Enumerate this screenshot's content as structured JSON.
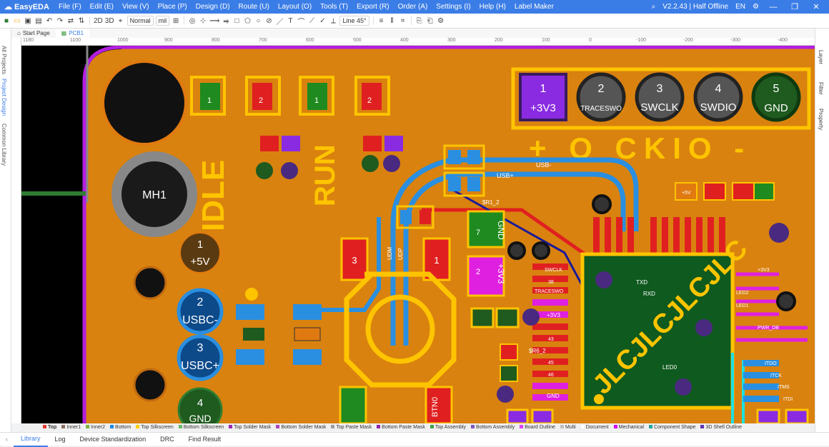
{
  "app": {
    "name": "EasyEDA",
    "version": "V2.2.43 | Half Offline",
    "lang": "EN"
  },
  "menu": [
    "File (F)",
    "Edit (E)",
    "View (V)",
    "Place (P)",
    "Design (D)",
    "Route (U)",
    "Layout (O)",
    "Tools (T)",
    "Export (R)",
    "Order (A)",
    "Settings (I)",
    "Help (H)",
    "Label Maker"
  ],
  "toolbar": {
    "view2d": "2D",
    "view3d": "3D",
    "mode": "Normal",
    "unit": "mil",
    "line_angle": "Line 45°"
  },
  "left_tabs": [
    "All Projects",
    "Project Design",
    "Common Library"
  ],
  "right_tabs": [
    "Layer",
    "Filter",
    "Property"
  ],
  "doc_tabs": [
    "Start Page",
    "PCB1"
  ],
  "ruler": [
    "1180",
    "1100",
    "1000",
    "900",
    "800",
    "700",
    "600",
    "500",
    "400",
    "300",
    "200",
    "100",
    "0",
    "-100",
    "-200",
    "-300",
    "-400"
  ],
  "pcb": {
    "silk": {
      "idle": "IDLE",
      "run": "RUN",
      "header_legend": "+ O CKIO -",
      "jlc": "JLCJLCJLCJLC",
      "mh1": "MH1"
    },
    "header_pins": [
      {
        "num": "1",
        "net": "+3V3"
      },
      {
        "num": "2",
        "net": "TRACESWO"
      },
      {
        "num": "3",
        "net": "SWCLK"
      },
      {
        "num": "4",
        "net": "SWDIO"
      },
      {
        "num": "5",
        "net": "GND"
      }
    ],
    "left_pins": [
      {
        "num": "1",
        "net": "+5V"
      },
      {
        "num": "2",
        "net": "USBC-"
      },
      {
        "num": "3",
        "net": "USBC+"
      },
      {
        "num": "4",
        "net": "GND"
      }
    ],
    "pads": {
      "led3_1": "1",
      "led3_2": "2",
      "led4_1": "1",
      "led4_2": "2",
      "sw_3": "3",
      "sw_1": "1",
      "gnd_pad": "GND",
      "v33_pad": "+3V3",
      "btn": "BTN0",
      "num7": "7",
      "num2": "2"
    },
    "nets": {
      "usbm": "USB-",
      "usbp": "USB+",
      "ud": "UDM",
      "udp": "UDP",
      "traceswo": "TRACESWO",
      "swclk": "SWCLK",
      "r1": "$R1_2",
      "r6": "$R6_2",
      "rxd": "RXD",
      "txd": "TXD",
      "pwr": "PWR_DB",
      "led0": "LED0",
      "led1": "LED1",
      "led2": "LED2",
      "itdo": "ITDO",
      "itck": "ITCK",
      "itms": "ITMS",
      "itdi": "ITDI",
      "v5": "+5V",
      "v33": "+3V3",
      "gnd": "GND"
    },
    "pin_numbers": [
      "38",
      "43",
      "45",
      "46",
      "39"
    ]
  },
  "layers": [
    {
      "name": "Top",
      "color": "#e53935"
    },
    {
      "name": "Inner1",
      "color": "#8d6e63"
    },
    {
      "name": "Inner2",
      "color": "#7cb342"
    },
    {
      "name": "Bottom",
      "color": "#1e88e5"
    },
    {
      "name": "Top Silkscreen",
      "color": "#ffcc00"
    },
    {
      "name": "Bottom Silkscreen",
      "color": "#66bb6a"
    },
    {
      "name": "Top Solder Mask",
      "color": "#9c27b0"
    },
    {
      "name": "Bottom Solder Mask",
      "color": "#ab47bc"
    },
    {
      "name": "Top Paste Mask",
      "color": "#9e9e9e"
    },
    {
      "name": "Bottom Paste Mask",
      "color": "#8e24aa"
    },
    {
      "name": "Top Assembly",
      "color": "#43a047"
    },
    {
      "name": "Bottom Assembly",
      "color": "#7e57c2"
    },
    {
      "name": "Board Outline",
      "color": "#e040fb"
    },
    {
      "name": "Multi",
      "color": "#c0c0c0"
    },
    {
      "name": "Document",
      "color": "#ffffff"
    },
    {
      "name": "Mechanical",
      "color": "#d500f9"
    },
    {
      "name": "Component Shape",
      "color": "#26a69a"
    },
    {
      "name": "3D Shell Outline",
      "color": "#5e35b1"
    }
  ],
  "bottom_tabs": [
    "Library",
    "Log",
    "Device Standardization",
    "DRC",
    "Find Result"
  ],
  "colors": {
    "board": "#d9820f",
    "copper_top": "#e02020",
    "copper_bottom": "#2a8fe0",
    "silk": "#ffc400",
    "pad_green": "#1f8a1f",
    "pad_purple": "#8a2be2",
    "accent": "#3b7de6"
  }
}
